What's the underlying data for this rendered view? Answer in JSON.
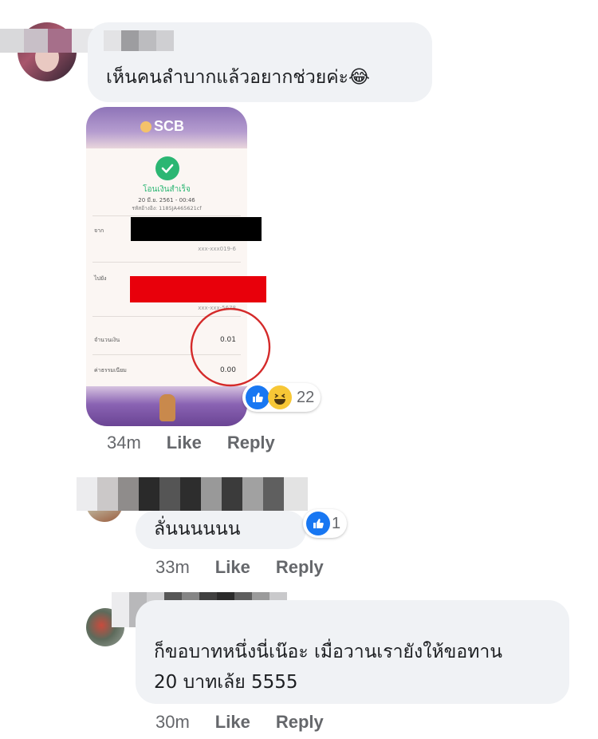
{
  "comments": [
    {
      "text": "เห็นคนลำบากแล้วอยากช่วยค่ะ😂",
      "time": "34m",
      "like_label": "Like",
      "reply_label": "Reply",
      "reaction_count": "22",
      "reactions": [
        "like-icon",
        "haha-icon"
      ]
    },
    {
      "text": "ลั่นนนนนน",
      "time": "33m",
      "like_label": "Like",
      "reply_label": "Reply",
      "reaction_count": "1",
      "reactions": [
        "like-icon"
      ]
    },
    {
      "text_line1": "ก็ขอบาทหนึ่งนี่เน๊อะ เมื่อวานเรายังให้ขอทาน",
      "text_line2": "20 บาทเล้ย 5555",
      "time": "30m",
      "like_label": "Like",
      "reply_label": "Reply"
    }
  ],
  "receipt": {
    "brand": "SCB",
    "status": "โอนเงินสำเร็จ",
    "date": "20 มี.ย. 2561 - 00:46",
    "ref": "รหัสอ้างอิง: 1185JA465621cf",
    "from_label": "จาก",
    "from_account": "xxx-xxx019-6",
    "to_label": "ไปยัง",
    "to_account": "xxx-xxx-5678",
    "amount_label": "จำนวนเงิน",
    "amount": "0.01",
    "fee_label": "ค่าธรรมเนียม",
    "fee": "0.00"
  },
  "colors": {
    "like_blue": "#1877f2",
    "bubble_gray": "#f0f2f5",
    "meta_gray": "#65676b",
    "redact_black": "#000000",
    "redact_red": "#e8000b",
    "circle_red": "#d42a2a",
    "success_green": "#2bb673"
  }
}
